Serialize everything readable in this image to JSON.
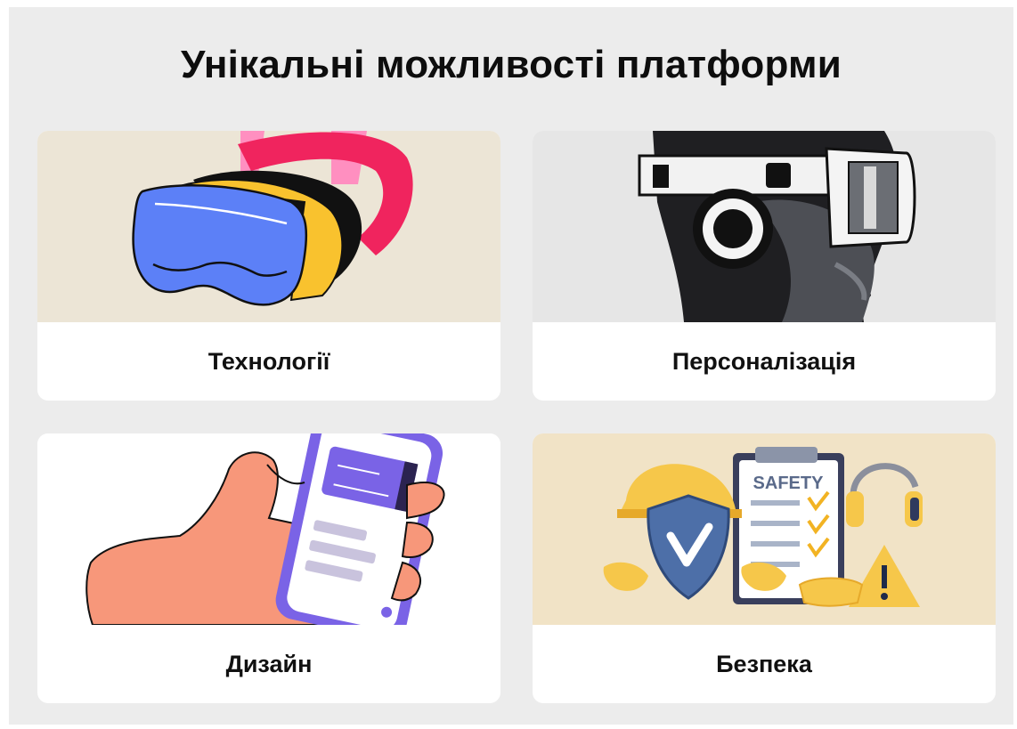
{
  "page": {
    "title": "Унікальні можливості платформи"
  },
  "cards": [
    {
      "label": "Технології",
      "image_bg": "#ece5d6",
      "icon": "vr-headset-icon"
    },
    {
      "label": "Персоналізація",
      "image_bg": "#e6e6e6",
      "icon": "vr-person-icon"
    },
    {
      "label": "Дизайн",
      "image_bg": "#ffffff",
      "icon": "hand-smartphone-icon"
    },
    {
      "label": "Безпека",
      "image_bg": "#f1e3c6",
      "icon": "safety-checklist-icon"
    }
  ],
  "safety_sign": "SAFETY"
}
